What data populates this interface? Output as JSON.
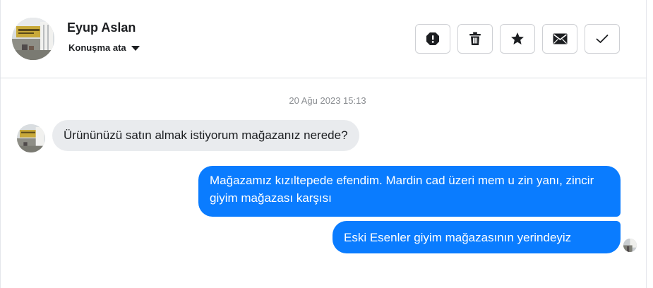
{
  "header": {
    "contact_name": "Eyup Aslan",
    "assign_label": "Konuşma ata",
    "actions": [
      {
        "name": "spam",
        "icon": "alert-octagon-icon"
      },
      {
        "name": "delete",
        "icon": "trash-icon"
      },
      {
        "name": "star",
        "icon": "star-icon"
      },
      {
        "name": "mark-unread",
        "icon": "envelope-icon"
      },
      {
        "name": "mark-done",
        "icon": "checkmark-icon"
      }
    ]
  },
  "conversation": {
    "timestamp": "20 Ağu 2023 15:13",
    "messages": [
      {
        "direction": "incoming",
        "text": "Ürününüzü satın almak istiyorum mağazanız nerede?"
      },
      {
        "direction": "outgoing",
        "text": "Mağazamız kızıltepede efendim. Mardin cad üzeri mem u zin yanı, zincir giyim mağazası karşısı"
      },
      {
        "direction": "outgoing",
        "text": "Eski Esenler giyim  mağazasının yerindeyiz"
      }
    ]
  },
  "colors": {
    "outgoing_bubble": "#0a7cff",
    "incoming_bubble": "#e9ebee",
    "text": "#1c1e21",
    "muted_text": "#8a8d91",
    "border": "#ced0d4"
  }
}
